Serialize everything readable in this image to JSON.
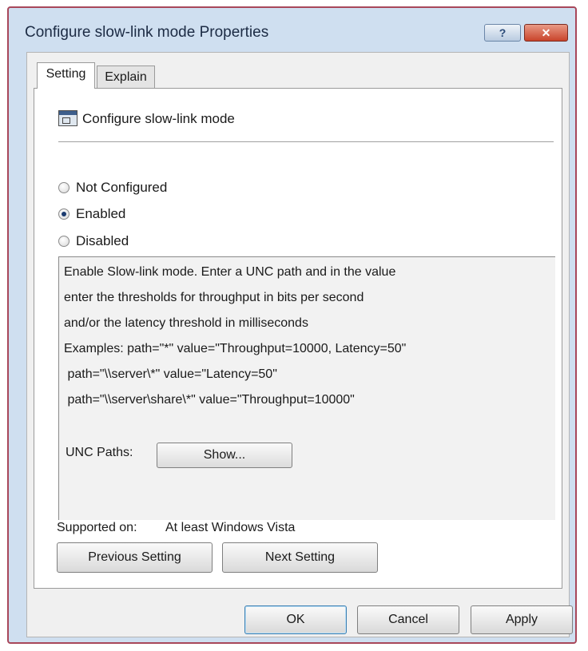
{
  "window": {
    "title": "Configure slow-link mode Properties",
    "help_glyph": "?",
    "close_glyph": "✕"
  },
  "tabs": [
    {
      "label": "Setting",
      "selected": true
    },
    {
      "label": "Explain",
      "selected": false
    }
  ],
  "policy": {
    "name": "Configure slow-link mode",
    "icon": "policy-setting-icon"
  },
  "state": {
    "options": [
      {
        "label": "Not Configured",
        "checked": false
      },
      {
        "label": "Enabled",
        "checked": true
      },
      {
        "label": "Disabled",
        "checked": false
      }
    ]
  },
  "help": {
    "lines": [
      "Enable Slow-link mode. Enter a UNC path and in the value",
      "enter the thresholds for throughput in bits per second",
      "and/or the latency threshold in milliseconds",
      "Examples: path=\"*\" value=\"Throughput=10000, Latency=50\"",
      " path=\"\\\\server\\*\" value=\"Latency=50\"",
      " path=\"\\\\server\\share\\*\" value=\"Throughput=10000\""
    ],
    "unc_label": "UNC Paths:",
    "show_button": "Show..."
  },
  "supported": {
    "label": "Supported on:",
    "value": "At least Windows Vista"
  },
  "nav": {
    "previous": "Previous Setting",
    "next": "Next Setting"
  },
  "buttons": {
    "ok": "OK",
    "cancel": "Cancel",
    "apply": "Apply"
  },
  "colors": {
    "window_border": "#a8475a",
    "title_bar": "#cfdff0",
    "close_button": "#c9442b"
  }
}
